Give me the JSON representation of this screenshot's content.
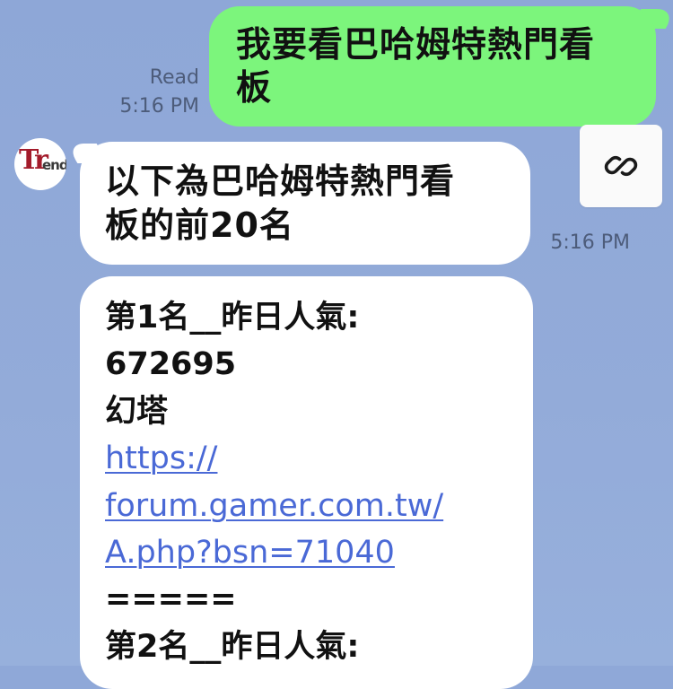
{
  "outgoing": {
    "line1": "我要看巴哈姆特熱門看",
    "line2": "板",
    "status": "Read",
    "time": "5:16 PM",
    "bubble_color": "#7cf57c"
  },
  "incoming": {
    "avatar": {
      "text_big": "Tr",
      "text_small": "end",
      "brand_color": "#a31b2b"
    },
    "message1": {
      "line1": "以下為巴哈姆特熱門看",
      "line2": "板的前20名",
      "time": "5:16 PM"
    },
    "share_button_icon": "link-icon",
    "message2": {
      "lines": [
        "第1名__昨日人氣:",
        "672695",
        "幻塔"
      ],
      "link_lines": [
        "https://",
        "forum.gamer.com.tw/",
        "A.php?bsn=71040"
      ],
      "separator": "=====",
      "next_line": "第2名__昨日人氣:",
      "link_color": "#4a69d6"
    }
  },
  "background_color": "#8fa8d8"
}
